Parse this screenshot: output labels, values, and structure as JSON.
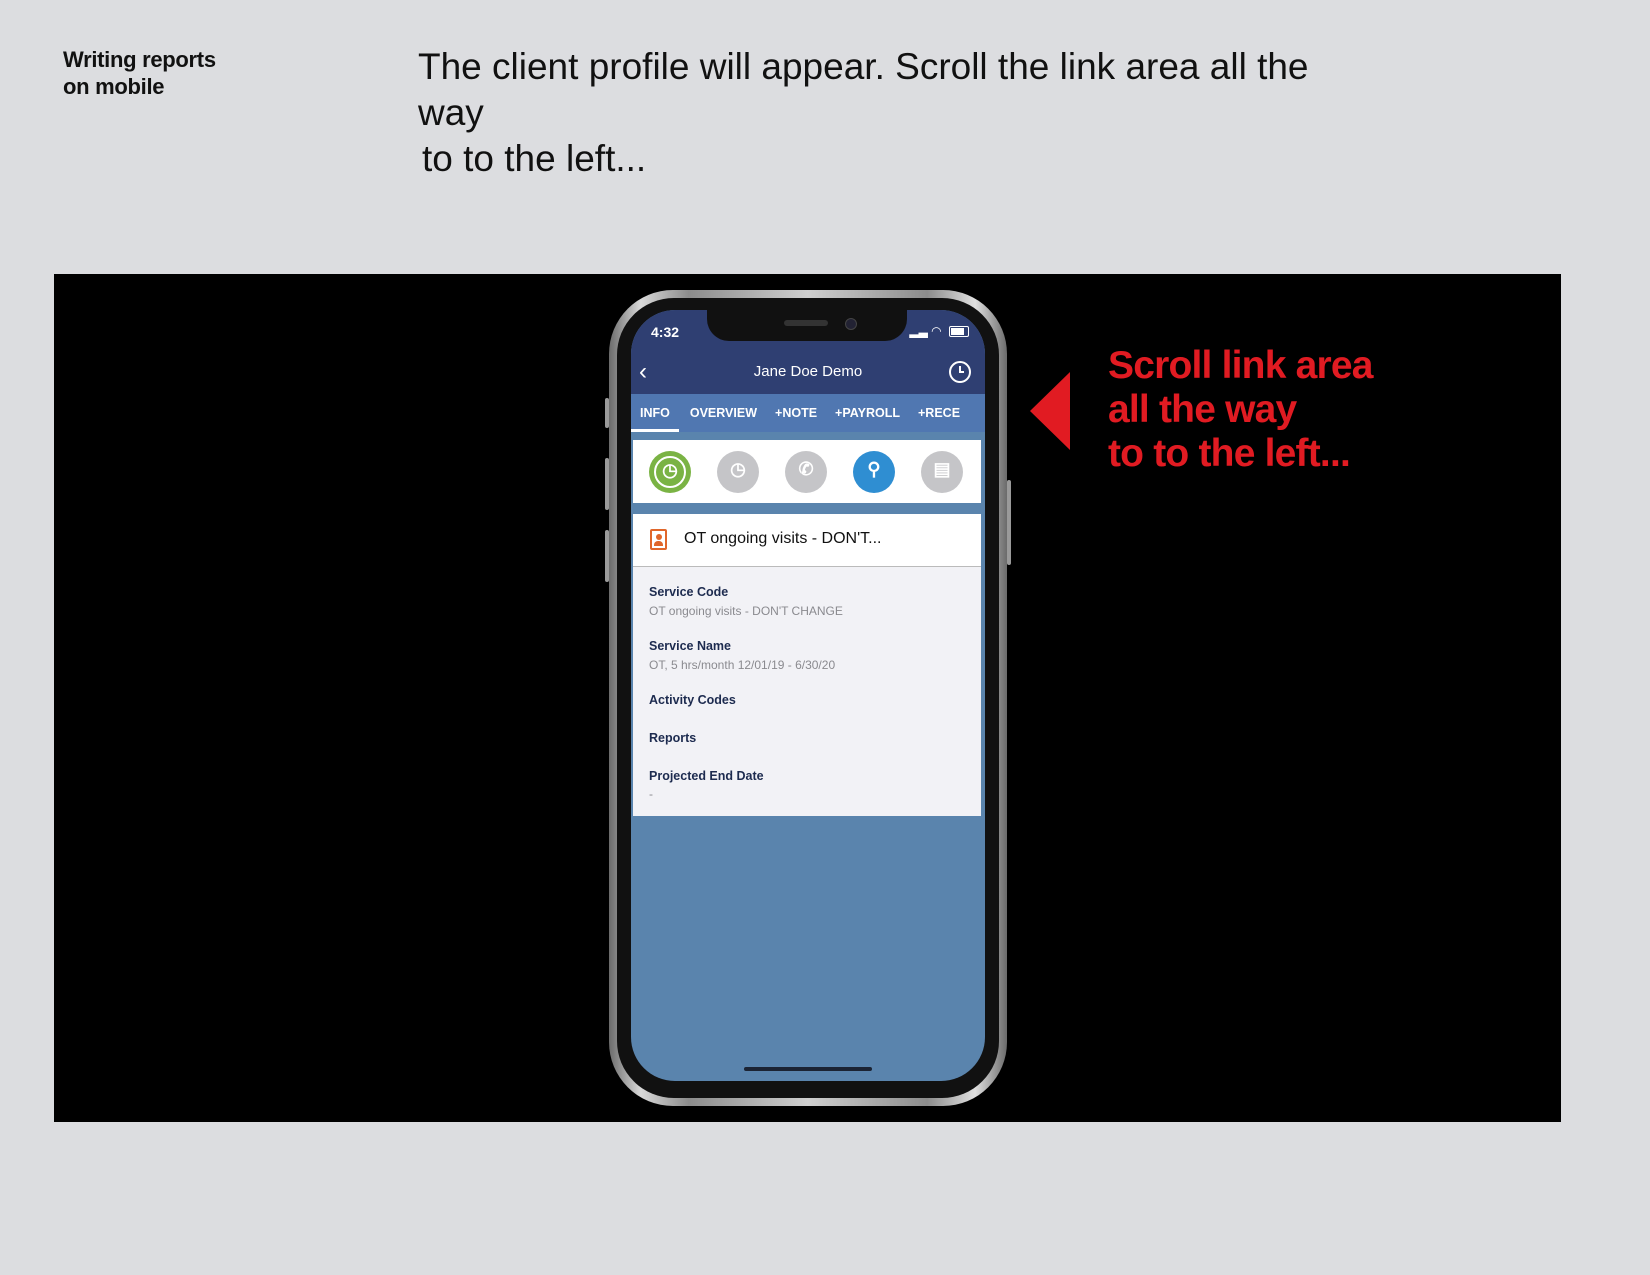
{
  "slide": {
    "side_title_line1": "Writing reports",
    "side_title_line2": "on mobile",
    "instruction_line1": "The client profile will appear. Scroll the link area all the way",
    "instruction_line2": "to to the left..."
  },
  "callout": {
    "line1": "Scroll link area",
    "line2": "all the way",
    "line3": "to to the left..."
  },
  "phone": {
    "status": {
      "time": "4:32"
    },
    "nav": {
      "title": "Jane Doe Demo"
    },
    "tabs": [
      "INFO",
      "OVERVIEW",
      "+NOTE",
      "+PAYROLL",
      "+RECE"
    ],
    "card": {
      "title": "OT ongoing visits - DON'T..."
    },
    "fields": [
      {
        "label": "Service Code",
        "value": "OT ongoing visits - DON'T CHANGE"
      },
      {
        "label": "Service Name",
        "value": "OT, 5 hrs/month 12/01/19 - 6/30/20"
      },
      {
        "label": "Activity Codes",
        "value": ""
      },
      {
        "label": "Reports",
        "value": ""
      },
      {
        "label": "Projected End Date",
        "value": "-"
      }
    ]
  },
  "colors": {
    "callout_red": "#e11b22",
    "nav_blue": "#2f3f72",
    "tab_blue": "#5077b1",
    "screen_blue": "#5a84ad",
    "green": "#7ab344",
    "location_blue": "#2f8ed2",
    "gray_icon": "#c5c5c8",
    "orange": "#e0662a"
  },
  "icons": [
    "back-chevron-icon",
    "clock-icon",
    "timer-icon",
    "clock-disabled-icon",
    "phone-icon",
    "location-pin-icon",
    "contact-card-icon",
    "clipboard-person-icon"
  ]
}
